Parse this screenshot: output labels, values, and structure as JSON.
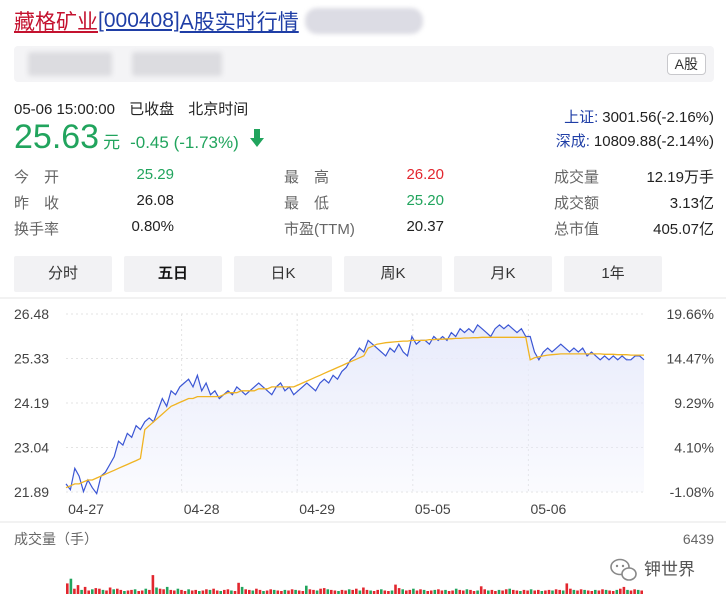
{
  "header": {
    "stock_name": "藏格矿业",
    "stock_code": "[000408]",
    "title_suffix": "A股实时行情",
    "market_tag": "A股"
  },
  "quote": {
    "date_time": "05-06 15:00:00",
    "status": "已收盘",
    "timezone": "北京时间",
    "price": "25.63",
    "unit": "元",
    "change": "-0.45 (-1.73%)"
  },
  "indices": [
    {
      "name": "上证:",
      "value": "3001.56(-2.16%)"
    },
    {
      "name": "深成:",
      "value": "10809.88(-2.14%)"
    }
  ],
  "stats": [
    {
      "label": "今　开",
      "value": "25.29",
      "color": "green"
    },
    {
      "label": "最　高",
      "value": "26.20",
      "color": "red"
    },
    {
      "label": "成交量",
      "value": "12.19万手",
      "color": ""
    },
    {
      "label": "昨　收",
      "value": "26.08",
      "color": ""
    },
    {
      "label": "最　低",
      "value": "25.20",
      "color": "green"
    },
    {
      "label": "成交额",
      "value": "3.13亿",
      "color": ""
    },
    {
      "label": "换手率",
      "value": "0.80%",
      "color": ""
    },
    {
      "label": "市盈(TTM)",
      "value": "20.37",
      "color": ""
    },
    {
      "label": "总市值",
      "value": "405.07亿",
      "color": ""
    }
  ],
  "tabs": [
    {
      "label": "分时",
      "active": false
    },
    {
      "label": "五日",
      "active": true
    },
    {
      "label": "日K",
      "active": false
    },
    {
      "label": "周K",
      "active": false
    },
    {
      "label": "月K",
      "active": false
    },
    {
      "label": "1年",
      "active": false
    }
  ],
  "colors": {
    "price_line": "#3b56d4",
    "avg_line": "#f0b422",
    "area_fill": "#e8ebfb",
    "up": "#e2262e",
    "down": "#21a45d"
  },
  "chart_data": {
    "type": "line",
    "y_ticks_price": [
      "26.48",
      "25.33",
      "24.19",
      "23.04",
      "21.89"
    ],
    "y_ticks_pct": [
      "19.66%",
      "14.47%",
      "9.29%",
      "4.10%",
      "-1.08%"
    ],
    "ylim": [
      21.89,
      26.48
    ],
    "x_labels": [
      "04-27",
      "04-28",
      "04-29",
      "05-05",
      "05-06"
    ],
    "price_series": [
      22.1,
      21.95,
      22.5,
      22.3,
      21.9,
      22.2,
      22.0,
      21.85,
      22.3,
      22.4,
      22.6,
      22.8,
      23.2,
      23.1,
      23.4,
      23.3,
      23.6,
      23.5,
      23.7,
      23.8,
      23.7,
      24.0,
      24.3,
      24.1,
      24.5,
      24.4,
      24.6,
      24.7,
      24.8,
      24.6,
      24.9,
      24.5,
      24.7,
      24.4,
      24.5,
      24.3,
      24.4,
      24.5,
      24.4,
      24.6,
      24.5,
      24.4,
      24.5,
      24.6,
      24.7,
      24.6,
      24.5,
      24.4,
      24.6,
      24.7,
      24.5,
      24.6,
      24.4,
      24.5,
      24.6,
      24.7,
      24.6,
      24.5,
      24.7,
      24.8,
      24.7,
      24.9,
      24.8,
      25.0,
      25.1,
      25.3,
      25.4,
      25.6,
      25.5,
      25.8,
      25.7,
      25.6,
      25.5,
      25.4,
      25.6,
      25.5,
      25.7,
      25.5,
      25.4,
      25.9,
      25.7,
      25.8,
      25.8,
      25.7,
      25.9,
      25.8,
      25.9,
      25.8,
      26.0,
      25.9,
      26.1,
      26.0,
      26.1,
      26.0,
      26.2,
      26.1,
      26.0,
      25.9,
      26.1,
      26.2,
      26.1,
      26.2,
      26.1,
      26.0,
      26.1,
      25.9,
      25.9,
      25.5,
      25.3,
      25.5,
      25.6,
      25.5,
      25.6,
      25.7,
      25.6,
      25.5,
      25.6,
      25.5,
      25.6,
      25.4,
      25.5,
      25.4,
      25.3,
      25.4,
      25.3,
      25.4,
      25.3,
      25.4,
      25.3,
      25.3,
      25.4,
      25.4,
      25.3
    ],
    "avg_series": [
      22.0,
      22.05,
      22.1,
      22.1,
      22.15,
      22.2,
      22.2,
      22.25,
      22.3,
      22.35,
      22.4,
      22.45,
      22.5,
      22.55,
      22.6,
      22.65,
      22.7,
      22.75,
      23.5,
      23.6,
      23.7,
      23.8,
      23.9,
      24.0,
      24.1,
      24.15,
      24.2,
      24.25,
      24.3,
      24.3,
      24.35,
      24.35,
      24.35,
      24.35,
      24.35,
      24.35,
      24.4,
      24.45,
      24.45,
      24.45,
      24.5,
      24.5,
      24.5,
      24.5,
      24.55,
      24.55,
      24.55,
      24.6,
      24.6,
      24.6,
      24.6,
      24.6,
      24.6,
      24.65,
      24.7,
      24.75,
      24.8,
      24.85,
      24.9,
      24.95,
      25.0,
      25.05,
      25.1,
      25.15,
      25.2,
      25.25,
      25.3,
      25.35,
      25.4,
      25.6,
      25.65,
      25.7,
      25.72,
      25.74,
      25.75,
      25.76,
      25.77,
      25.78,
      25.78,
      25.8,
      25.8,
      25.8,
      25.8,
      25.82,
      25.82,
      25.83,
      25.83,
      25.84,
      25.84,
      25.85,
      25.85,
      25.86,
      25.86,
      25.87,
      25.87,
      25.88,
      25.88,
      25.88,
      25.88,
      25.88,
      25.88,
      25.88,
      25.88,
      25.88,
      25.88,
      25.88,
      25.3,
      25.35,
      25.38,
      25.4,
      25.42,
      25.43,
      25.44,
      25.45,
      25.45,
      25.45,
      25.45,
      25.45,
      25.45,
      25.45,
      25.45,
      25.45,
      25.45,
      25.44,
      25.44,
      25.44,
      25.43,
      25.43,
      25.43,
      25.42,
      25.42,
      25.42,
      25.42
    ],
    "volume_label": "成交量（手）",
    "volume_max_label": "6439",
    "volume_max": 6439,
    "volume_series": [
      1800,
      2600,
      900,
      1500,
      700,
      1200,
      600,
      800,
      1000,
      900,
      700,
      600,
      1100,
      800,
      900,
      700,
      500,
      600,
      700,
      800,
      500,
      600,
      900,
      700,
      3200,
      1100,
      900,
      800,
      1200,
      700,
      600,
      900,
      700,
      500,
      800,
      600,
      700,
      500,
      600,
      800,
      700,
      900,
      600,
      500,
      700,
      800,
      600,
      500,
      1900,
      1200,
      800,
      700,
      600,
      900,
      700,
      500,
      600,
      800,
      700,
      600,
      500,
      700,
      600,
      800,
      700,
      600,
      500,
      1400,
      800,
      700,
      600,
      900,
      1000,
      800,
      700,
      600,
      500,
      700,
      600,
      800,
      700,
      900,
      600,
      1100,
      700,
      600,
      500,
      700,
      800,
      600,
      500,
      600,
      1600,
      1000,
      800,
      600,
      700,
      900,
      600,
      800,
      700,
      500,
      600,
      700,
      800,
      600,
      700,
      500,
      600,
      900,
      700,
      600,
      800,
      700,
      500,
      600,
      1300,
      800,
      600,
      700,
      500,
      700,
      600,
      800,
      900,
      700,
      600,
      500,
      700,
      600,
      800,
      600,
      700,
      500,
      600,
      700,
      600,
      800,
      700,
      600,
      1800,
      900,
      700,
      600,
      800,
      700,
      600,
      500,
      700,
      600,
      800,
      700,
      600,
      500,
      700,
      900,
      1200,
      700,
      600,
      800,
      700,
      600
    ]
  },
  "watermark": {
    "text": "钾世界"
  }
}
